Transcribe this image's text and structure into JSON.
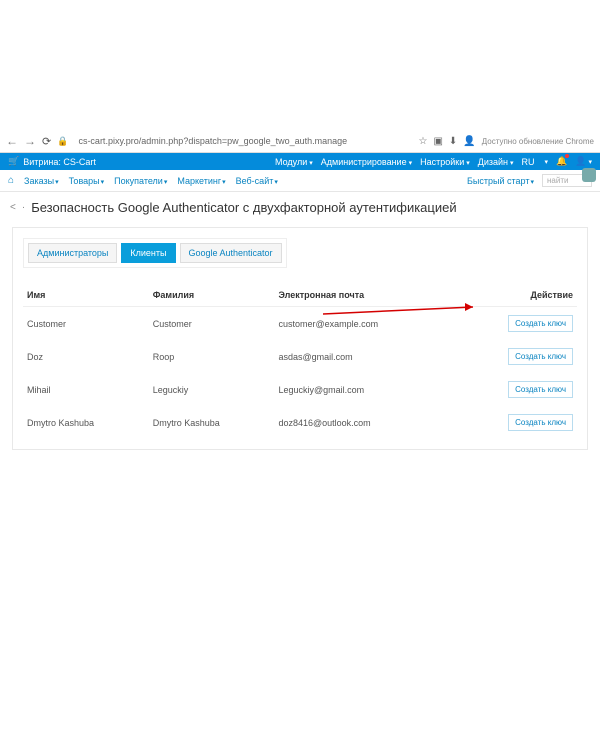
{
  "browser": {
    "url": "cs-cart.pixy.pro/admin.php?dispatch=pw_google_two_auth.manage",
    "update_msg": "Доступно обновление Chrome"
  },
  "topbar": {
    "store_label": "Витрина: CS-Cart",
    "modules": "Модули",
    "admin": "Администрирование",
    "settings": "Настройки",
    "design": "Дизайн",
    "lang": "RU"
  },
  "menu": {
    "orders": "Заказы",
    "products": "Товары",
    "customers": "Покупатели",
    "marketing": "Маркетинг",
    "website": "Веб-сайт",
    "quickstart": "Быстрый старт",
    "search_ph": "найти"
  },
  "page": {
    "title": "Безопасность Google Authenticator с двухфакторной аутентификацией"
  },
  "tabs": {
    "admins": "Администраторы",
    "clients": "Клиенты",
    "ga": "Google Authenticator"
  },
  "table": {
    "h_name": "Имя",
    "h_lastname": "Фамилия",
    "h_email": "Электронная почта",
    "h_action": "Действие",
    "action_label": "Создать ключ",
    "rows": [
      {
        "name": "Customer",
        "lastname": "Customer",
        "email": "customer@example.com"
      },
      {
        "name": "Doz",
        "lastname": "Roop",
        "email": "asdas@gmail.com"
      },
      {
        "name": "Mihail",
        "lastname": "Leguckiy",
        "email": "Leguckiy@gmail.com"
      },
      {
        "name": "Dmytro Kashuba",
        "lastname": "Dmytro Kashuba",
        "email": "doz8416@outlook.com"
      }
    ]
  }
}
